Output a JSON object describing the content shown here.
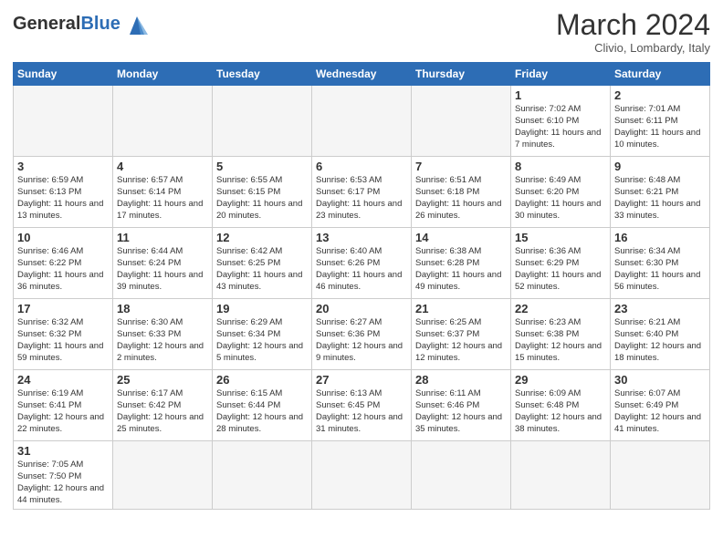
{
  "header": {
    "logo_general": "General",
    "logo_blue": "Blue",
    "title": "March 2024",
    "subtitle": "Clivio, Lombardy, Italy"
  },
  "weekdays": [
    "Sunday",
    "Monday",
    "Tuesday",
    "Wednesday",
    "Thursday",
    "Friday",
    "Saturday"
  ],
  "weeks": [
    [
      {
        "day": "",
        "info": ""
      },
      {
        "day": "",
        "info": ""
      },
      {
        "day": "",
        "info": ""
      },
      {
        "day": "",
        "info": ""
      },
      {
        "day": "",
        "info": ""
      },
      {
        "day": "1",
        "info": "Sunrise: 7:02 AM\nSunset: 6:10 PM\nDaylight: 11 hours and 7 minutes."
      },
      {
        "day": "2",
        "info": "Sunrise: 7:01 AM\nSunset: 6:11 PM\nDaylight: 11 hours and 10 minutes."
      }
    ],
    [
      {
        "day": "3",
        "info": "Sunrise: 6:59 AM\nSunset: 6:13 PM\nDaylight: 11 hours and 13 minutes."
      },
      {
        "day": "4",
        "info": "Sunrise: 6:57 AM\nSunset: 6:14 PM\nDaylight: 11 hours and 17 minutes."
      },
      {
        "day": "5",
        "info": "Sunrise: 6:55 AM\nSunset: 6:15 PM\nDaylight: 11 hours and 20 minutes."
      },
      {
        "day": "6",
        "info": "Sunrise: 6:53 AM\nSunset: 6:17 PM\nDaylight: 11 hours and 23 minutes."
      },
      {
        "day": "7",
        "info": "Sunrise: 6:51 AM\nSunset: 6:18 PM\nDaylight: 11 hours and 26 minutes."
      },
      {
        "day": "8",
        "info": "Sunrise: 6:49 AM\nSunset: 6:20 PM\nDaylight: 11 hours and 30 minutes."
      },
      {
        "day": "9",
        "info": "Sunrise: 6:48 AM\nSunset: 6:21 PM\nDaylight: 11 hours and 33 minutes."
      }
    ],
    [
      {
        "day": "10",
        "info": "Sunrise: 6:46 AM\nSunset: 6:22 PM\nDaylight: 11 hours and 36 minutes."
      },
      {
        "day": "11",
        "info": "Sunrise: 6:44 AM\nSunset: 6:24 PM\nDaylight: 11 hours and 39 minutes."
      },
      {
        "day": "12",
        "info": "Sunrise: 6:42 AM\nSunset: 6:25 PM\nDaylight: 11 hours and 43 minutes."
      },
      {
        "day": "13",
        "info": "Sunrise: 6:40 AM\nSunset: 6:26 PM\nDaylight: 11 hours and 46 minutes."
      },
      {
        "day": "14",
        "info": "Sunrise: 6:38 AM\nSunset: 6:28 PM\nDaylight: 11 hours and 49 minutes."
      },
      {
        "day": "15",
        "info": "Sunrise: 6:36 AM\nSunset: 6:29 PM\nDaylight: 11 hours and 52 minutes."
      },
      {
        "day": "16",
        "info": "Sunrise: 6:34 AM\nSunset: 6:30 PM\nDaylight: 11 hours and 56 minutes."
      }
    ],
    [
      {
        "day": "17",
        "info": "Sunrise: 6:32 AM\nSunset: 6:32 PM\nDaylight: 11 hours and 59 minutes."
      },
      {
        "day": "18",
        "info": "Sunrise: 6:30 AM\nSunset: 6:33 PM\nDaylight: 12 hours and 2 minutes."
      },
      {
        "day": "19",
        "info": "Sunrise: 6:29 AM\nSunset: 6:34 PM\nDaylight: 12 hours and 5 minutes."
      },
      {
        "day": "20",
        "info": "Sunrise: 6:27 AM\nSunset: 6:36 PM\nDaylight: 12 hours and 9 minutes."
      },
      {
        "day": "21",
        "info": "Sunrise: 6:25 AM\nSunset: 6:37 PM\nDaylight: 12 hours and 12 minutes."
      },
      {
        "day": "22",
        "info": "Sunrise: 6:23 AM\nSunset: 6:38 PM\nDaylight: 12 hours and 15 minutes."
      },
      {
        "day": "23",
        "info": "Sunrise: 6:21 AM\nSunset: 6:40 PM\nDaylight: 12 hours and 18 minutes."
      }
    ],
    [
      {
        "day": "24",
        "info": "Sunrise: 6:19 AM\nSunset: 6:41 PM\nDaylight: 12 hours and 22 minutes."
      },
      {
        "day": "25",
        "info": "Sunrise: 6:17 AM\nSunset: 6:42 PM\nDaylight: 12 hours and 25 minutes."
      },
      {
        "day": "26",
        "info": "Sunrise: 6:15 AM\nSunset: 6:44 PM\nDaylight: 12 hours and 28 minutes."
      },
      {
        "day": "27",
        "info": "Sunrise: 6:13 AM\nSunset: 6:45 PM\nDaylight: 12 hours and 31 minutes."
      },
      {
        "day": "28",
        "info": "Sunrise: 6:11 AM\nSunset: 6:46 PM\nDaylight: 12 hours and 35 minutes."
      },
      {
        "day": "29",
        "info": "Sunrise: 6:09 AM\nSunset: 6:48 PM\nDaylight: 12 hours and 38 minutes."
      },
      {
        "day": "30",
        "info": "Sunrise: 6:07 AM\nSunset: 6:49 PM\nDaylight: 12 hours and 41 minutes."
      }
    ],
    [
      {
        "day": "31",
        "info": "Sunrise: 7:05 AM\nSunset: 7:50 PM\nDaylight: 12 hours and 44 minutes."
      },
      {
        "day": "",
        "info": ""
      },
      {
        "day": "",
        "info": ""
      },
      {
        "day": "",
        "info": ""
      },
      {
        "day": "",
        "info": ""
      },
      {
        "day": "",
        "info": ""
      },
      {
        "day": "",
        "info": ""
      }
    ]
  ]
}
